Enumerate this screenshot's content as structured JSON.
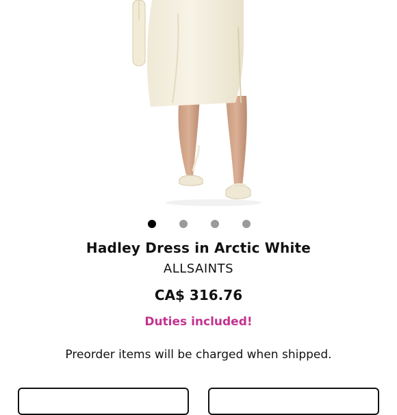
{
  "product": {
    "image_alt": "Hadley Dress in Arctic White",
    "carousel": {
      "count": 4,
      "active_index": 0
    },
    "title": "Hadley Dress in Arctic White",
    "brand": "ALLSAINTS",
    "price": "CA$ 316.76",
    "duties_note": "Duties included!",
    "preorder_note": "Preorder items will be charged when shipped."
  },
  "colors": {
    "duties_accent": "#c2338f",
    "dot_active": "#000000",
    "dot_inactive": "#9a9a9a"
  }
}
